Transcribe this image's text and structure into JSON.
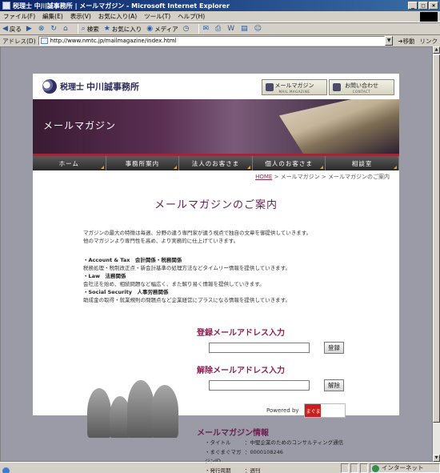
{
  "window": {
    "title": "税理士 中川誠事務所 | メールマガジン - Microsoft Internet Explorer",
    "buttons": [
      "_",
      "□",
      "×"
    ]
  },
  "menu": [
    "ファイル(F)",
    "編集(E)",
    "表示(V)",
    "お気に入り(A)",
    "ツール(T)",
    "ヘルプ(H)"
  ],
  "toolbar": {
    "back": "戻る",
    "search": "検索",
    "favorites": "お気に入り",
    "media": "メディア"
  },
  "address": {
    "label": "アドレス(D)",
    "url": "http://www.nmtc.jp/mailmagazine/index.html",
    "go": "移動",
    "links": "リンク"
  },
  "status": {
    "text": "",
    "zone": "インターネット"
  },
  "site": {
    "logo_prefix": "税理士",
    "logo_name": "中川誠事務所",
    "header_buttons": [
      {
        "label": "メールマガジン",
        "sub": "MAIL MAGAZINE"
      },
      {
        "label": "お問い合わせ",
        "sub": "CONTACT"
      }
    ],
    "banner_title": "メールマガジン",
    "nav": [
      "ホーム",
      "事務所案内",
      "法人のお客さま",
      "個人のお客さま",
      "相談室"
    ],
    "breadcrumb": {
      "home": "HOME",
      "rest": " > メールマガジン > メールマガジンのご案内"
    },
    "page_title": "メールマガジンのご案内",
    "intro": [
      "マガジンの最大の特徴は毎週、分野の違う専門家が違う視点で独自の文章を御提供していきます。",
      "他のマガジンより専門性を高め、より実務的に仕上げていきます。"
    ],
    "sections": [
      {
        "head": "・Account & Tax　会計関係・税務関係",
        "body": "税務処理・税制改正点・新会計基準の処理方法などタイムリー情報を提供していきます。"
      },
      {
        "head": "・Law　法務関係",
        "body": "会社法を始め、相続問題など幅広く、また解り易く情報を提供していきます。"
      },
      {
        "head": "・Social Security　人事労務関係",
        "body": "助成金の取得・就業規則の問題点など企業経営にプラスになる情報を提供していきます。"
      }
    ],
    "register": {
      "label": "登録メールアドレス入力",
      "button": "登録",
      "placeholder": ""
    },
    "unregister": {
      "label": "解除メールアドレス入力",
      "button": "解除",
      "placeholder": ""
    },
    "powered_by": "Powered by",
    "powered_logo": "まぐまぐ",
    "info": {
      "title": "メールマガジン情報",
      "rows": [
        {
          "k": "・タイトル",
          "v": "：中堅企業のためのコンサルティング通信"
        },
        {
          "k": "・まぐまぐマガジンID",
          "v": "：0000108246"
        },
        {
          "k": "・発行周期",
          "v": "：週刊"
        }
      ]
    }
  },
  "colors": {
    "accent": "#6a2050",
    "banner": "#5a2f52",
    "nav": "#2a2a2a",
    "ie_blue": "#0a246a"
  }
}
